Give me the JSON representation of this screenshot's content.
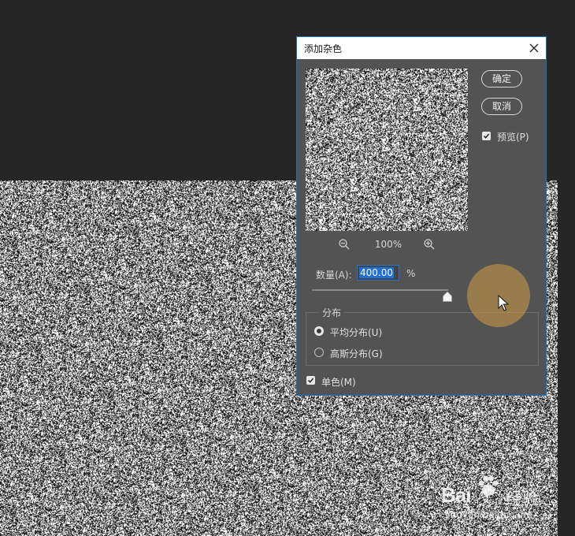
{
  "dialog": {
    "title": "添加杂色",
    "ok_label": "确定",
    "cancel_label": "取消",
    "preview_label": "预览(P)",
    "preview_checked": true,
    "zoom_level": "100%",
    "amount_label": "数量(A):",
    "amount_value": "400.00",
    "amount_unit": "%",
    "slider_value_fraction": 1.0,
    "distribution_legend": "分布",
    "distribution_options": [
      {
        "label": "平均分布(U)",
        "selected": true
      },
      {
        "label": "高斯分布(G)",
        "selected": false
      }
    ],
    "monochrome_label": "单色(M)",
    "monochrome_checked": true
  },
  "icons": {
    "close": "close-icon",
    "zoom_out": "zoom-out-icon",
    "zoom_in": "zoom-in-icon",
    "cursor": "mouse-pointer-icon"
  },
  "colors": {
    "workspace": "#262626",
    "dialog_bg": "#535353",
    "dialog_border": "#1473c9",
    "selection": "#1f6fd6",
    "click_indicator": "#c49648"
  },
  "watermark": {
    "logo": "Bai",
    "logo_tail": "经验",
    "url": "jingyan.baidu.com"
  }
}
